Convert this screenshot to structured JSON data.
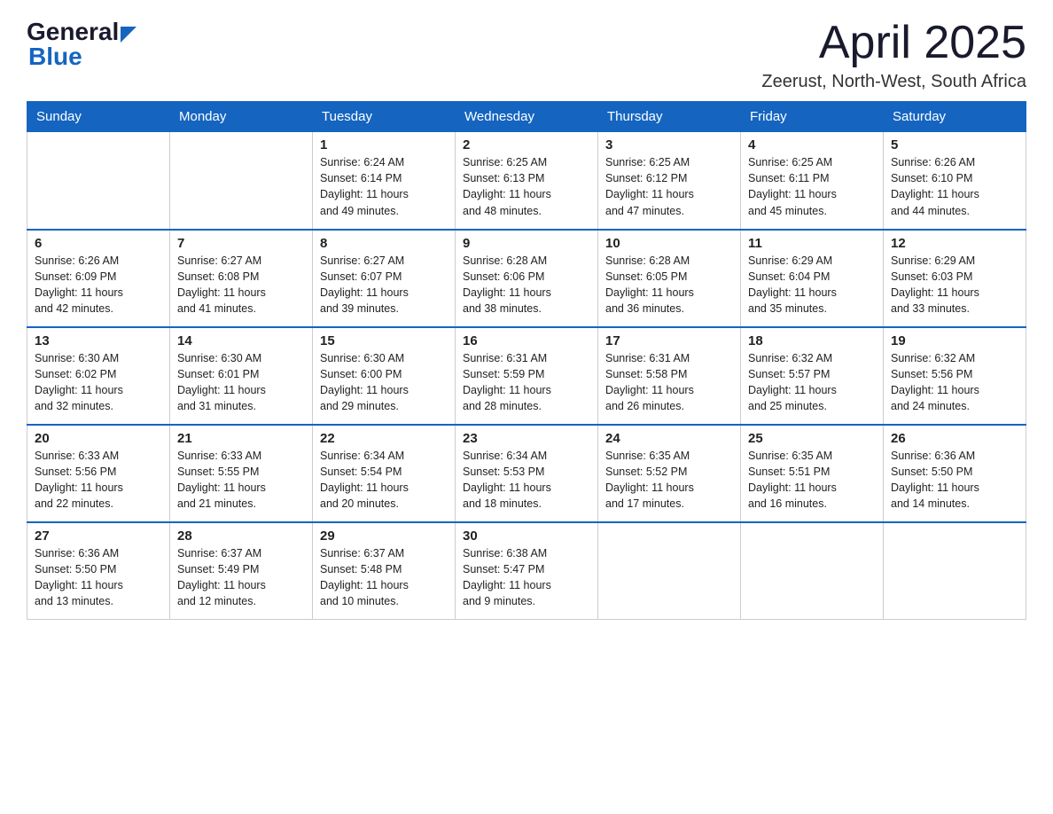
{
  "header": {
    "logo_general": "General",
    "logo_blue": "Blue",
    "month_title": "April 2025",
    "location": "Zeerust, North-West, South Africa"
  },
  "weekdays": [
    "Sunday",
    "Monday",
    "Tuesday",
    "Wednesday",
    "Thursday",
    "Friday",
    "Saturday"
  ],
  "weeks": [
    [
      {
        "day": "",
        "info": ""
      },
      {
        "day": "",
        "info": ""
      },
      {
        "day": "1",
        "info": "Sunrise: 6:24 AM\nSunset: 6:14 PM\nDaylight: 11 hours\nand 49 minutes."
      },
      {
        "day": "2",
        "info": "Sunrise: 6:25 AM\nSunset: 6:13 PM\nDaylight: 11 hours\nand 48 minutes."
      },
      {
        "day": "3",
        "info": "Sunrise: 6:25 AM\nSunset: 6:12 PM\nDaylight: 11 hours\nand 47 minutes."
      },
      {
        "day": "4",
        "info": "Sunrise: 6:25 AM\nSunset: 6:11 PM\nDaylight: 11 hours\nand 45 minutes."
      },
      {
        "day": "5",
        "info": "Sunrise: 6:26 AM\nSunset: 6:10 PM\nDaylight: 11 hours\nand 44 minutes."
      }
    ],
    [
      {
        "day": "6",
        "info": "Sunrise: 6:26 AM\nSunset: 6:09 PM\nDaylight: 11 hours\nand 42 minutes."
      },
      {
        "day": "7",
        "info": "Sunrise: 6:27 AM\nSunset: 6:08 PM\nDaylight: 11 hours\nand 41 minutes."
      },
      {
        "day": "8",
        "info": "Sunrise: 6:27 AM\nSunset: 6:07 PM\nDaylight: 11 hours\nand 39 minutes."
      },
      {
        "day": "9",
        "info": "Sunrise: 6:28 AM\nSunset: 6:06 PM\nDaylight: 11 hours\nand 38 minutes."
      },
      {
        "day": "10",
        "info": "Sunrise: 6:28 AM\nSunset: 6:05 PM\nDaylight: 11 hours\nand 36 minutes."
      },
      {
        "day": "11",
        "info": "Sunrise: 6:29 AM\nSunset: 6:04 PM\nDaylight: 11 hours\nand 35 minutes."
      },
      {
        "day": "12",
        "info": "Sunrise: 6:29 AM\nSunset: 6:03 PM\nDaylight: 11 hours\nand 33 minutes."
      }
    ],
    [
      {
        "day": "13",
        "info": "Sunrise: 6:30 AM\nSunset: 6:02 PM\nDaylight: 11 hours\nand 32 minutes."
      },
      {
        "day": "14",
        "info": "Sunrise: 6:30 AM\nSunset: 6:01 PM\nDaylight: 11 hours\nand 31 minutes."
      },
      {
        "day": "15",
        "info": "Sunrise: 6:30 AM\nSunset: 6:00 PM\nDaylight: 11 hours\nand 29 minutes."
      },
      {
        "day": "16",
        "info": "Sunrise: 6:31 AM\nSunset: 5:59 PM\nDaylight: 11 hours\nand 28 minutes."
      },
      {
        "day": "17",
        "info": "Sunrise: 6:31 AM\nSunset: 5:58 PM\nDaylight: 11 hours\nand 26 minutes."
      },
      {
        "day": "18",
        "info": "Sunrise: 6:32 AM\nSunset: 5:57 PM\nDaylight: 11 hours\nand 25 minutes."
      },
      {
        "day": "19",
        "info": "Sunrise: 6:32 AM\nSunset: 5:56 PM\nDaylight: 11 hours\nand 24 minutes."
      }
    ],
    [
      {
        "day": "20",
        "info": "Sunrise: 6:33 AM\nSunset: 5:56 PM\nDaylight: 11 hours\nand 22 minutes."
      },
      {
        "day": "21",
        "info": "Sunrise: 6:33 AM\nSunset: 5:55 PM\nDaylight: 11 hours\nand 21 minutes."
      },
      {
        "day": "22",
        "info": "Sunrise: 6:34 AM\nSunset: 5:54 PM\nDaylight: 11 hours\nand 20 minutes."
      },
      {
        "day": "23",
        "info": "Sunrise: 6:34 AM\nSunset: 5:53 PM\nDaylight: 11 hours\nand 18 minutes."
      },
      {
        "day": "24",
        "info": "Sunrise: 6:35 AM\nSunset: 5:52 PM\nDaylight: 11 hours\nand 17 minutes."
      },
      {
        "day": "25",
        "info": "Sunrise: 6:35 AM\nSunset: 5:51 PM\nDaylight: 11 hours\nand 16 minutes."
      },
      {
        "day": "26",
        "info": "Sunrise: 6:36 AM\nSunset: 5:50 PM\nDaylight: 11 hours\nand 14 minutes."
      }
    ],
    [
      {
        "day": "27",
        "info": "Sunrise: 6:36 AM\nSunset: 5:50 PM\nDaylight: 11 hours\nand 13 minutes."
      },
      {
        "day": "28",
        "info": "Sunrise: 6:37 AM\nSunset: 5:49 PM\nDaylight: 11 hours\nand 12 minutes."
      },
      {
        "day": "29",
        "info": "Sunrise: 6:37 AM\nSunset: 5:48 PM\nDaylight: 11 hours\nand 10 minutes."
      },
      {
        "day": "30",
        "info": "Sunrise: 6:38 AM\nSunset: 5:47 PM\nDaylight: 11 hours\nand 9 minutes."
      },
      {
        "day": "",
        "info": ""
      },
      {
        "day": "",
        "info": ""
      },
      {
        "day": "",
        "info": ""
      }
    ]
  ]
}
